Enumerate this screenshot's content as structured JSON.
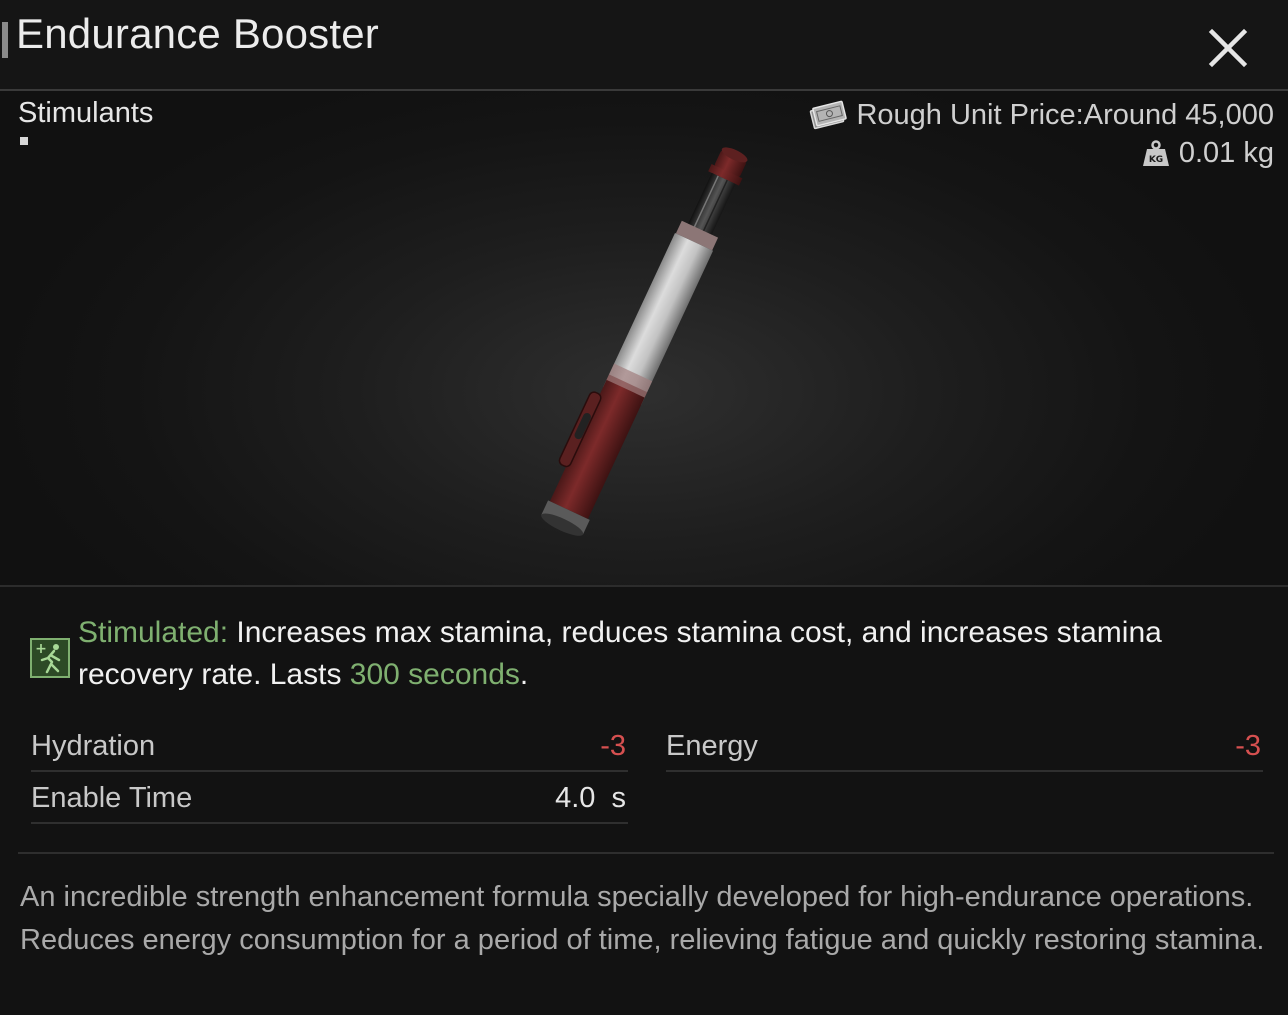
{
  "item": {
    "title": "Endurance Booster",
    "category": "Stimulants",
    "price_label": "Rough Unit Price:Around 45,000",
    "weight_label": "0.01 kg"
  },
  "effect": {
    "name": "Stimulated:",
    "text_a": " Increases max stamina, reduces stamina cost, and increases stamina recovery rate. Lasts ",
    "duration": "300 seconds",
    "text_b": "."
  },
  "stats": [
    {
      "label": "Hydration",
      "value": "-3",
      "tone": "negative"
    },
    {
      "label": "Energy",
      "value": "-3",
      "tone": "negative"
    },
    {
      "label": "Enable Time",
      "value": "4.0  s",
      "tone": "neutral"
    }
  ],
  "description": "An incredible strength enhancement formula specially developed for high-endurance operations. Reduces energy consumption for a period of time, relieving fatigue and quickly restoring stamina.",
  "icons": {
    "close": "close-icon",
    "price": "money-icon",
    "weight": "kg-weight-icon",
    "effect": "running-stamina-icon"
  },
  "colors": {
    "effect_green": "#7fb070",
    "negative_red": "#d65050"
  }
}
